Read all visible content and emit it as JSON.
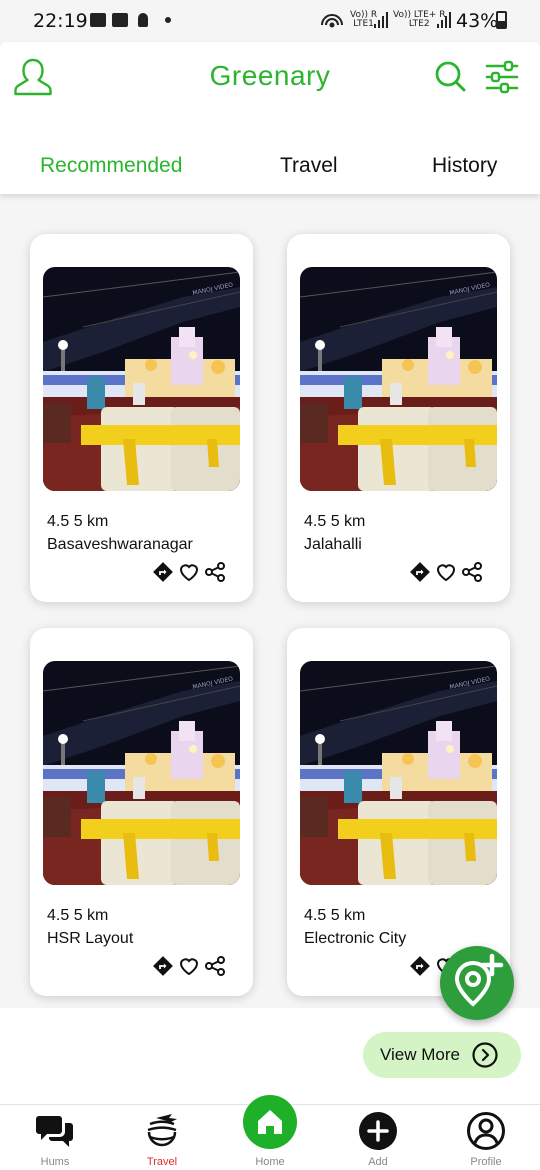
{
  "status_bar": {
    "time": "22:19",
    "sim1_line1": "Vo)) R",
    "sim1_line2": "LTE1",
    "sim2_line1": "Vo)) LTE+ R",
    "sim2_line2": "LTE2",
    "battery": "43%"
  },
  "header": {
    "title": "Greenary",
    "accent_color": "#2bb52f"
  },
  "tabs": [
    {
      "label": "Recommended",
      "active": true
    },
    {
      "label": "Travel",
      "active": false
    },
    {
      "label": "History",
      "active": false
    }
  ],
  "cards": [
    {
      "distance": "4.5 5 km",
      "place": "Basaveshwaranagar",
      "photo_overlay": "MANOJ VIDEO"
    },
    {
      "distance": "4.5 5 km",
      "place": "Jalahalli",
      "photo_overlay": "MANOJ VIDEO"
    },
    {
      "distance": "4.5 5 km",
      "place": "HSR Layout",
      "photo_overlay": "MANOJ VIDEO"
    },
    {
      "distance": "4.5 5 km",
      "place": "Electronic City",
      "photo_overlay": "MANOJ VIDEO"
    }
  ],
  "view_more": {
    "label": "View More"
  },
  "bottom_nav": [
    {
      "label": "Hums",
      "icon": "chat-bubbles-icon"
    },
    {
      "label": "Travel",
      "icon": "globe-plane-icon",
      "active": true
    },
    {
      "label": "Home",
      "icon": "home-icon"
    },
    {
      "label": "Add",
      "icon": "add-circle-icon"
    },
    {
      "label": "Profile",
      "icon": "user-circle-icon"
    }
  ]
}
